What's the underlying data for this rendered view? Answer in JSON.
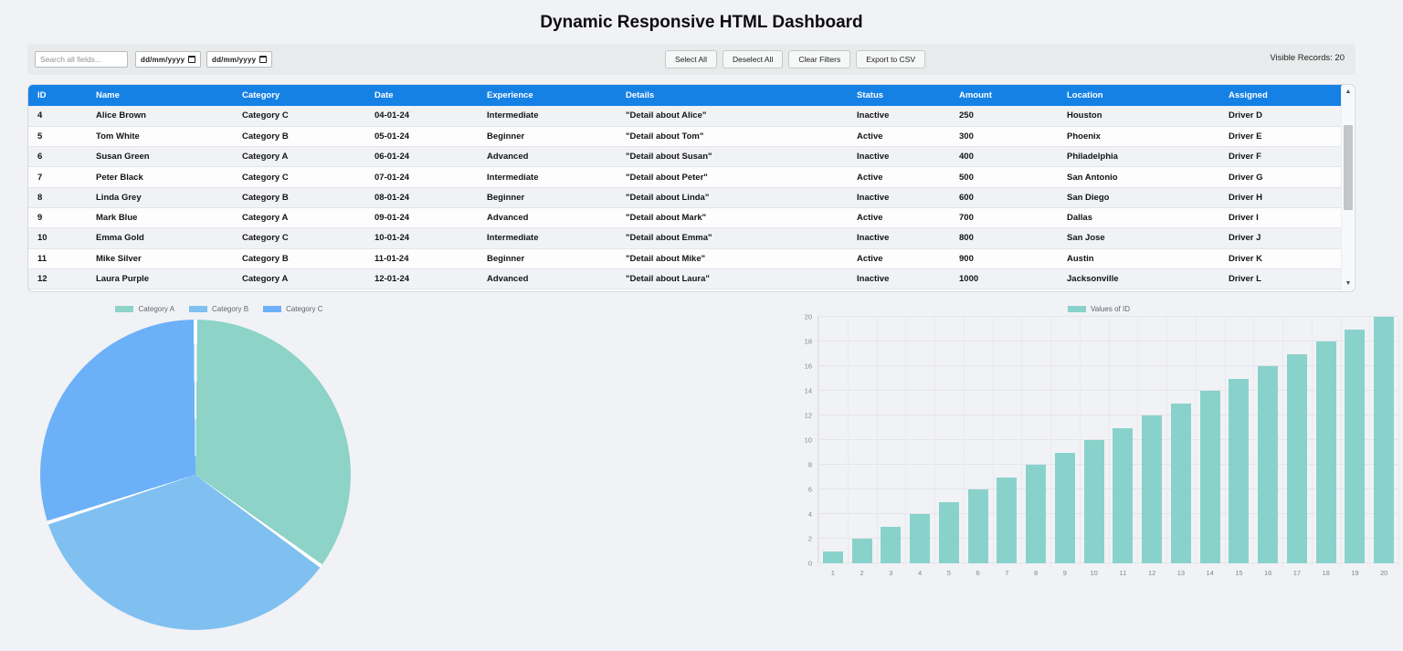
{
  "page": {
    "title": "Dynamic Responsive HTML Dashboard",
    "background": "#f1f2f6"
  },
  "toolbar": {
    "search_placeholder": "Search all fields...",
    "date_from": "dd/mm/yyyy",
    "date_to": "dd/mm/yyyy",
    "buttons": [
      {
        "id": "select-all",
        "label": "Select All"
      },
      {
        "id": "deselect-all",
        "label": "Deselect All"
      },
      {
        "id": "clear-filters",
        "label": "Clear Filters"
      },
      {
        "id": "export-csv",
        "label": "Export to CSV"
      }
    ],
    "visible_records": {
      "label": "Visible Records:",
      "value": "20"
    }
  },
  "table": {
    "header_bg": "#1681e4",
    "columns": [
      "ID",
      "Name",
      "Category",
      "Date",
      "Experience",
      "Details",
      "Status",
      "Amount",
      "Location",
      "Assigned"
    ],
    "column_keys": [
      "id",
      "name",
      "category",
      "date",
      "experience",
      "details",
      "status",
      "amount",
      "location",
      "assigned"
    ],
    "rows": [
      [
        "4",
        "Alice Brown",
        "Category C",
        "04-01-24",
        "Intermediate",
        "\"Detail about Alice\"",
        "Inactive",
        "250",
        "Houston",
        "Driver D"
      ],
      [
        "5",
        "Tom White",
        "Category B",
        "05-01-24",
        "Beginner",
        "\"Detail about Tom\"",
        "Active",
        "300",
        "Phoenix",
        "Driver E"
      ],
      [
        "6",
        "Susan Green",
        "Category A",
        "06-01-24",
        "Advanced",
        "\"Detail about Susan\"",
        "Inactive",
        "400",
        "Philadelphia",
        "Driver F"
      ],
      [
        "7",
        "Peter Black",
        "Category C",
        "07-01-24",
        "Intermediate",
        "\"Detail about Peter\"",
        "Active",
        "500",
        "San Antonio",
        "Driver G"
      ],
      [
        "8",
        "Linda Grey",
        "Category B",
        "08-01-24",
        "Beginner",
        "\"Detail about Linda\"",
        "Inactive",
        "600",
        "San Diego",
        "Driver H"
      ],
      [
        "9",
        "Mark Blue",
        "Category A",
        "09-01-24",
        "Advanced",
        "\"Detail about Mark\"",
        "Active",
        "700",
        "Dallas",
        "Driver I"
      ],
      [
        "10",
        "Emma Gold",
        "Category C",
        "10-01-24",
        "Intermediate",
        "\"Detail about Emma\"",
        "Inactive",
        "800",
        "San Jose",
        "Driver J"
      ],
      [
        "11",
        "Mike Silver",
        "Category B",
        "11-01-24",
        "Beginner",
        "\"Detail about Mike\"",
        "Active",
        "900",
        "Austin",
        "Driver K"
      ],
      [
        "12",
        "Laura Purple",
        "Category A",
        "12-01-24",
        "Advanced",
        "\"Detail about Laura\"",
        "Inactive",
        "1000",
        "Jacksonville",
        "Driver L"
      ]
    ]
  },
  "chart_data": [
    {
      "type": "pie",
      "legend_position": "top",
      "slices": [
        {
          "label": "Category A",
          "value": 7,
          "color": "#8dd3c7"
        },
        {
          "label": "Category B",
          "value": 7,
          "color": "#80c0f0"
        },
        {
          "label": "Category C",
          "value": 6,
          "color": "#6cb1f8"
        }
      ],
      "start_angle_deg": 0,
      "direction": "clockwise"
    },
    {
      "type": "bar",
      "legend": "Values of ID",
      "bar_color": "#89d2cb",
      "categories": [
        1,
        2,
        3,
        4,
        5,
        6,
        7,
        8,
        9,
        10,
        11,
        12,
        13,
        14,
        15,
        16,
        17,
        18,
        19,
        20
      ],
      "values": [
        1,
        2,
        3,
        4,
        5,
        6,
        7,
        8,
        9,
        10,
        11,
        12,
        13,
        14,
        15,
        16,
        17,
        18,
        19,
        20
      ],
      "xlabel": "",
      "ylabel": "",
      "ylim": [
        0,
        20
      ],
      "ytick_step": 2,
      "grid": true,
      "legend_position": "top"
    }
  ]
}
